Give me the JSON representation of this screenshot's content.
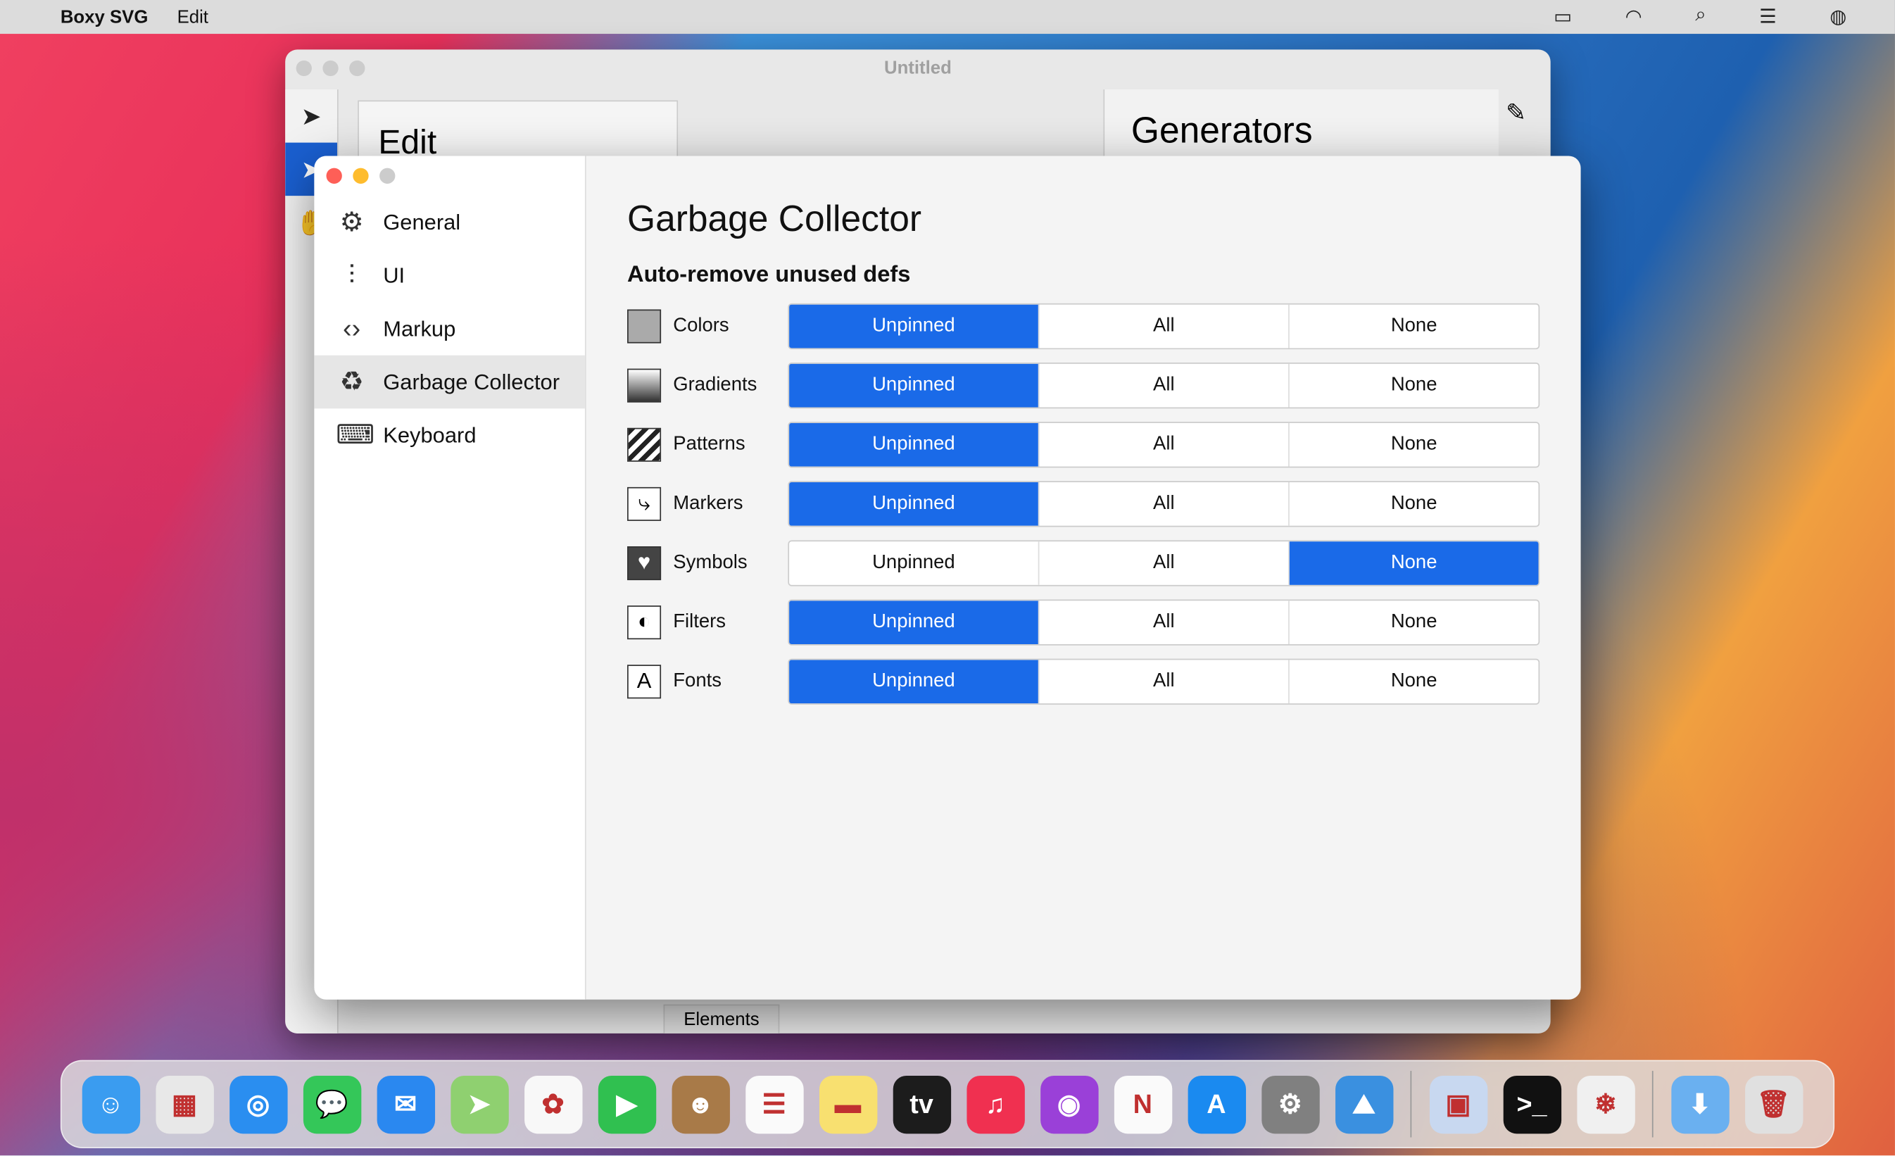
{
  "menubar": {
    "app": "Boxy SVG",
    "menus": [
      "Edit"
    ],
    "status_icons": [
      "display-icon",
      "wifi-icon",
      "search-icon",
      "control-center-icon",
      "siri-icon"
    ]
  },
  "window": {
    "title": "Untitled",
    "edit_panel": "Edit",
    "generators_panel": "Generators",
    "elements_tab": "Elements"
  },
  "dialog": {
    "sidebar": [
      {
        "label": "General",
        "icon": "gear-icon"
      },
      {
        "label": "UI",
        "icon": "sliders-icon"
      },
      {
        "label": "Markup",
        "icon": "code-icon"
      },
      {
        "label": "Garbage Collector",
        "icon": "recycle-icon",
        "selected": true
      },
      {
        "label": "Keyboard",
        "icon": "keyboard-icon"
      }
    ],
    "title": "Garbage Collector",
    "subtitle": "Auto-remove unused defs",
    "options": [
      "Unpinned",
      "All",
      "None"
    ],
    "rows": [
      {
        "label": "Colors",
        "icon": "color-swatch-icon",
        "value": "Unpinned"
      },
      {
        "label": "Gradients",
        "icon": "gradient-icon",
        "value": "Unpinned"
      },
      {
        "label": "Patterns",
        "icon": "pattern-icon",
        "value": "Unpinned"
      },
      {
        "label": "Markers",
        "icon": "marker-icon",
        "value": "Unpinned"
      },
      {
        "label": "Symbols",
        "icon": "heart-symbol-icon",
        "value": "None"
      },
      {
        "label": "Filters",
        "icon": "filter-icon",
        "value": "Unpinned"
      },
      {
        "label": "Fonts",
        "icon": "font-icon",
        "value": "Unpinned"
      }
    ],
    "accent": "#1a6ae8"
  },
  "dock": [
    {
      "name": "finder",
      "color": "#3a9cf0",
      "glyph": "☺"
    },
    {
      "name": "launchpad",
      "color": "#e8e8e8",
      "glyph": "▦"
    },
    {
      "name": "safari",
      "color": "#2a8ef0",
      "glyph": "◎"
    },
    {
      "name": "messages",
      "color": "#34c759",
      "glyph": "💬"
    },
    {
      "name": "mail",
      "color": "#2a88f0",
      "glyph": "✉"
    },
    {
      "name": "maps",
      "color": "#8fd070",
      "glyph": "➤"
    },
    {
      "name": "photos",
      "color": "#f8f8f8",
      "glyph": "✿"
    },
    {
      "name": "facetime",
      "color": "#30c050",
      "glyph": "▶"
    },
    {
      "name": "contacts",
      "color": "#a87a48",
      "glyph": "☻"
    },
    {
      "name": "reminders",
      "color": "#fafafa",
      "glyph": "☰"
    },
    {
      "name": "notes",
      "color": "#f8e070",
      "glyph": "▬"
    },
    {
      "name": "tv",
      "color": "#1c1c1c",
      "glyph": "tv"
    },
    {
      "name": "music",
      "color": "#f03050",
      "glyph": "♫"
    },
    {
      "name": "podcasts",
      "color": "#9a40d8",
      "glyph": "◉"
    },
    {
      "name": "news",
      "color": "#fafafa",
      "glyph": "N"
    },
    {
      "name": "app-store",
      "color": "#1a8af0",
      "glyph": "A"
    },
    {
      "name": "system-preferences",
      "color": "#808080",
      "glyph": "⚙"
    },
    {
      "name": "mountain-app",
      "color": "#3a90e0",
      "glyph": "⛰"
    },
    {
      "sep": true
    },
    {
      "name": "preview",
      "color": "#c8d8f0",
      "glyph": "▣"
    },
    {
      "name": "terminal",
      "color": "#111111",
      "glyph": ">_"
    },
    {
      "name": "boxy-svg",
      "color": "#f0f0f0",
      "glyph": "❄"
    },
    {
      "sep": true
    },
    {
      "name": "downloads",
      "color": "#6ab0f0",
      "glyph": "⬇"
    },
    {
      "name": "trash",
      "color": "#e0e0e0",
      "glyph": "🗑"
    }
  ]
}
